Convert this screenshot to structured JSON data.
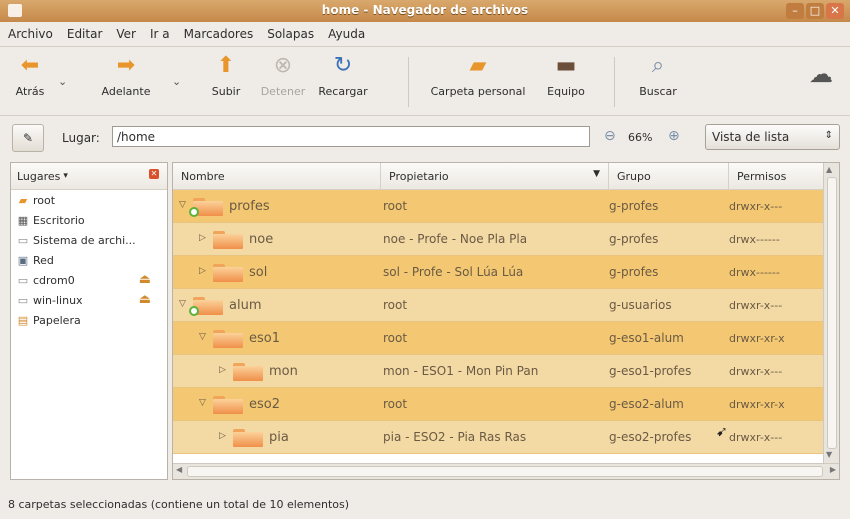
{
  "window": {
    "title": "home - Navegador de archivos"
  },
  "menu": [
    "Archivo",
    "Editar",
    "Ver",
    "Ir a",
    "Marcadores",
    "Solapas",
    "Ayuda"
  ],
  "toolbar": {
    "back": "Atrás",
    "forward": "Adelante",
    "up": "Subir",
    "stop": "Detener",
    "reload": "Recargar",
    "home": "Carpeta personal",
    "computer": "Equipo",
    "search": "Buscar"
  },
  "location": {
    "label": "Lugar:",
    "path": "/home",
    "zoom": "66%",
    "view": "Vista de lista"
  },
  "sidebar": {
    "title": "Lugares",
    "items": [
      {
        "label": "root",
        "icon": "home-folder-icon"
      },
      {
        "label": "Escritorio",
        "icon": "desktop-icon"
      },
      {
        "label": "Sistema de archi...",
        "icon": "drive-icon"
      },
      {
        "label": "Red",
        "icon": "network-icon"
      },
      {
        "label": "cdrom0",
        "icon": "cdrom-icon",
        "eject": true
      },
      {
        "label": "win-linux",
        "icon": "drive-icon",
        "eject": true
      },
      {
        "label": "Papelera",
        "icon": "trash-icon"
      }
    ]
  },
  "columns": [
    "Nombre",
    "Propietario",
    "Grupo",
    "Permisos"
  ],
  "rows": [
    {
      "name": "profes",
      "owner": "root",
      "group": "g-profes",
      "perms": "drwxr-x---",
      "level": 0,
      "expanded": true,
      "emblem": true
    },
    {
      "name": "noe",
      "owner": "noe - Profe - Noe Pla Pla",
      "group": "g-profes",
      "perms": "drwx------",
      "level": 1,
      "expanded": false
    },
    {
      "name": "sol",
      "owner": "sol - Profe - Sol Lúa Lúa",
      "group": "g-profes",
      "perms": "drwx------",
      "level": 1,
      "expanded": false
    },
    {
      "name": "alum",
      "owner": "root",
      "group": "g-usuarios",
      "perms": "drwxr-x---",
      "level": 0,
      "expanded": true,
      "emblem": true
    },
    {
      "name": "eso1",
      "owner": "root",
      "group": "g-eso1-alum",
      "perms": "drwxr-xr-x",
      "level": 1,
      "expanded": true
    },
    {
      "name": "mon",
      "owner": "mon - ESO1 - Mon Pin Pan",
      "group": "g-eso1-profes",
      "perms": "drwxr-x---",
      "level": 2,
      "expanded": false
    },
    {
      "name": "eso2",
      "owner": "root",
      "group": "g-eso2-alum",
      "perms": "drwxr-xr-x",
      "level": 1,
      "expanded": true
    },
    {
      "name": "pia",
      "owner": "pia - ESO2 - Pia Ras Ras",
      "group": "g-eso2-profes",
      "perms": "drwxr-x---",
      "level": 2,
      "expanded": false
    }
  ],
  "status": "8 carpetas seleccionadas (contiene un total de 10 elementos)",
  "colors": {
    "selected_row": "#f4c872",
    "titlebar": "#c5894a"
  }
}
